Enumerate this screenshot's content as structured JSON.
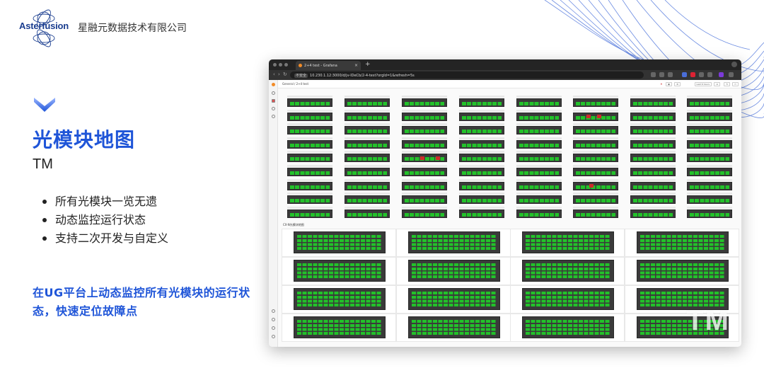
{
  "header": {
    "logo_text": "Asterfusion",
    "company_name": "星融元数据技术有限公司"
  },
  "left": {
    "title": "光模块地图",
    "subtitle": "TM",
    "bullets": [
      "所有光模块一览无遗",
      "动态监控运行状态",
      "支持二次开发与自定义"
    ],
    "tagline": "在UG平台上动态监控所有光模块的运行状态，快速定位故障点"
  },
  "browser": {
    "tab_title": "2+4 test - Grafana",
    "url_security": "不安全",
    "url": "10.230.1.12:3000/d/jv-lDeCb/2-4-test?orgId=1&refresh=5s"
  },
  "grafana": {
    "breadcrumb": "General / 2+4 test",
    "time_range": "Last 6 hours",
    "section_title": "CX-N光模块地图",
    "watermark": "TM"
  },
  "colors": {
    "accent_blue": "#1f55d8",
    "module_green": "#22c22a",
    "module_fault_red": "#d02a2a",
    "panel_dark": "#3a3a3a"
  },
  "icons": [
    "chevron-down-icon",
    "grafana-logo-icon",
    "search-icon",
    "star-icon",
    "share-icon",
    "refresh-icon",
    "settings-icon"
  ]
}
